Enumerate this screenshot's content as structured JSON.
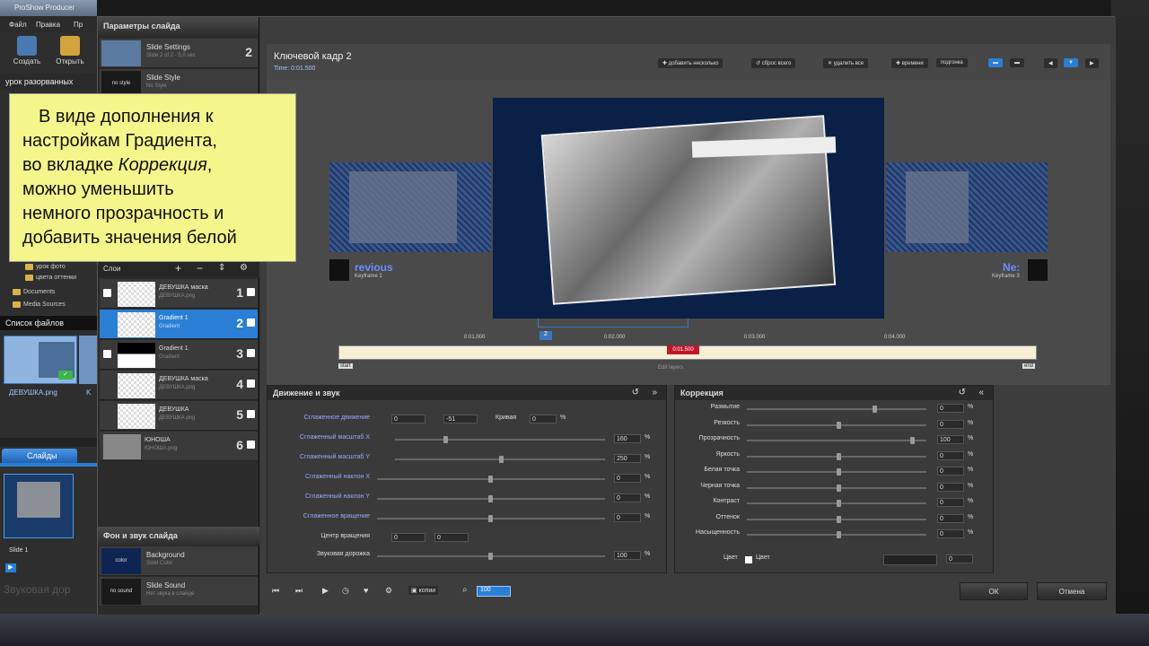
{
  "main_window": {
    "title": "ProShow Producer",
    "menu": [
      "Файл",
      "Правка",
      "Пр"
    ],
    "toolbar": [
      {
        "label": "Создать"
      },
      {
        "label": "Открыть"
      }
    ],
    "project_name": "урок разорванных",
    "folders": [
      "урок фото",
      "цвета оттенки",
      "Documents",
      "Media Sources"
    ],
    "file_list_title": "Список файлов",
    "file_name": "ДЕВУШКА.png",
    "file_name2": "K",
    "slides_tab": "Слайды",
    "slide_label": "Slide 1",
    "sound_track_label": "Звуковая дор"
  },
  "dialog": {
    "panel_title": "Параметры слайда",
    "slide_rows": [
      {
        "title": "Slide Settings",
        "sub": "Slide 2 of 2 - 5.0 sec",
        "num": "2"
      },
      {
        "title": "Slide Style",
        "sub": "No Style",
        "thumb": "no style"
      }
    ],
    "layers_title": "Слои",
    "layers": [
      {
        "title": "ДЕВУШКА маска",
        "sub": "ДЕВУШКА.png",
        "num": "1"
      },
      {
        "title": "Gradient 1",
        "sub": "Gradient",
        "num": "2"
      },
      {
        "title": "Gradient 1",
        "sub": "Gradient",
        "num": "3"
      },
      {
        "title": "ДЕВУШКА маска",
        "sub": "ДЕВУШКА.png",
        "num": "4"
      },
      {
        "title": "ДЕВУШКА",
        "sub": "ДЕВУШКА.png",
        "num": "5"
      },
      {
        "title": "ЮНОША",
        "sub": "ЮНОША.png",
        "num": "6"
      }
    ],
    "bg_title": "Фон и звук слайда",
    "bg_rows": [
      {
        "title": "Background",
        "sub": "Solid Color",
        "thumb": "color"
      },
      {
        "title": "Slide Sound",
        "sub": "Нет звука в слайде",
        "thumb": "no sound"
      }
    ]
  },
  "keyframe": {
    "title": "Ключевой кадр 2",
    "time": "Time: 0:01.500",
    "buttons": [
      "добавить несколько",
      "сброс всего",
      "удалить все",
      "времени",
      "подгонка"
    ]
  },
  "preview": {
    "previous_label": "revious",
    "previous_sub": "Keyframe 1",
    "next_label": "Ne:",
    "next_sub": "Keyframe 3",
    "timeline_ticks": [
      "0:01.000",
      "0:02.000",
      "0:03.000",
      "0:04.000"
    ],
    "current_time": "0:01.500",
    "marker_label": "2",
    "start_label": "start",
    "end_label": "end",
    "edit_label": "Edit layers"
  },
  "motion": {
    "title": "Движение и звук",
    "rows": [
      {
        "label": "Сглаженное движение",
        "v1": "0",
        "v2": "-51",
        "extra_label": "Кривая",
        "extra_val": "0"
      },
      {
        "label": "Сглаженный масштаб X",
        "value": "160"
      },
      {
        "label": "Сглаженный масштаб Y",
        "value": "250"
      },
      {
        "label": "Сглаженный наклон X",
        "value": "0"
      },
      {
        "label": "Сглаженный наклон Y",
        "value": "0"
      },
      {
        "label": "Сглаженное вращение",
        "value": "0"
      },
      {
        "label": "Центр вращения",
        "v1": "0",
        "v2": "0"
      },
      {
        "label": "Звуковая дорожка",
        "value": "100"
      }
    ]
  },
  "correction": {
    "title": "Коррекция",
    "rows": [
      {
        "label": "Размытие",
        "value": "0"
      },
      {
        "label": "Резкость",
        "value": "0"
      },
      {
        "label": "Прозрачность",
        "value": "100"
      },
      {
        "label": "Яркость",
        "value": "0"
      },
      {
        "label": "Белая точка",
        "value": "0"
      },
      {
        "label": "Черная точка",
        "value": "0"
      },
      {
        "label": "Контраст",
        "value": "0"
      },
      {
        "label": "Оттенок",
        "value": "0"
      },
      {
        "label": "Насыщенность",
        "value": "0"
      }
    ],
    "color_label": "Цвет",
    "color_check": "Цвет",
    "color_value": "0"
  },
  "bottom": {
    "copy_label": "копии",
    "zoom_value": "100",
    "ok": "ОК",
    "cancel": "Отмена"
  },
  "callout": {
    "line1": "В виде дополнения к",
    "line2": "настройкам Градиента,",
    "line3a": "во вкладке ",
    "line3b": "Коррекция",
    "line3c": ",",
    "line4": "можно уменьшить",
    "line5": "немного прозрачность и",
    "line6": "добавить значения белой"
  },
  "colors": {
    "accent": "#2a7fd4",
    "callout_bg": "#f4f58a",
    "timeline": "#f6efd6",
    "marker": "#c0182a",
    "label_blue": "#9aa7ff"
  }
}
